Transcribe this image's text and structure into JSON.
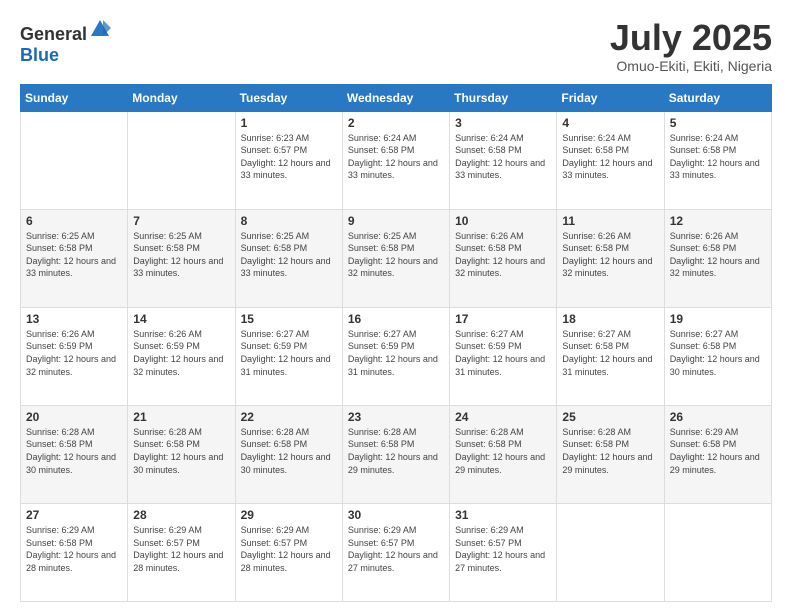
{
  "logo": {
    "text_general": "General",
    "text_blue": "Blue"
  },
  "header": {
    "month": "July 2025",
    "location": "Omuo-Ekiti, Ekiti, Nigeria"
  },
  "days_of_week": [
    "Sunday",
    "Monday",
    "Tuesday",
    "Wednesday",
    "Thursday",
    "Friday",
    "Saturday"
  ],
  "weeks": [
    [
      {
        "day": "",
        "sunrise": "",
        "sunset": "",
        "daylight": ""
      },
      {
        "day": "",
        "sunrise": "",
        "sunset": "",
        "daylight": ""
      },
      {
        "day": "1",
        "sunrise": "Sunrise: 6:23 AM",
        "sunset": "Sunset: 6:57 PM",
        "daylight": "Daylight: 12 hours and 33 minutes."
      },
      {
        "day": "2",
        "sunrise": "Sunrise: 6:24 AM",
        "sunset": "Sunset: 6:58 PM",
        "daylight": "Daylight: 12 hours and 33 minutes."
      },
      {
        "day": "3",
        "sunrise": "Sunrise: 6:24 AM",
        "sunset": "Sunset: 6:58 PM",
        "daylight": "Daylight: 12 hours and 33 minutes."
      },
      {
        "day": "4",
        "sunrise": "Sunrise: 6:24 AM",
        "sunset": "Sunset: 6:58 PM",
        "daylight": "Daylight: 12 hours and 33 minutes."
      },
      {
        "day": "5",
        "sunrise": "Sunrise: 6:24 AM",
        "sunset": "Sunset: 6:58 PM",
        "daylight": "Daylight: 12 hours and 33 minutes."
      }
    ],
    [
      {
        "day": "6",
        "sunrise": "Sunrise: 6:25 AM",
        "sunset": "Sunset: 6:58 PM",
        "daylight": "Daylight: 12 hours and 33 minutes."
      },
      {
        "day": "7",
        "sunrise": "Sunrise: 6:25 AM",
        "sunset": "Sunset: 6:58 PM",
        "daylight": "Daylight: 12 hours and 33 minutes."
      },
      {
        "day": "8",
        "sunrise": "Sunrise: 6:25 AM",
        "sunset": "Sunset: 6:58 PM",
        "daylight": "Daylight: 12 hours and 33 minutes."
      },
      {
        "day": "9",
        "sunrise": "Sunrise: 6:25 AM",
        "sunset": "Sunset: 6:58 PM",
        "daylight": "Daylight: 12 hours and 32 minutes."
      },
      {
        "day": "10",
        "sunrise": "Sunrise: 6:26 AM",
        "sunset": "Sunset: 6:58 PM",
        "daylight": "Daylight: 12 hours and 32 minutes."
      },
      {
        "day": "11",
        "sunrise": "Sunrise: 6:26 AM",
        "sunset": "Sunset: 6:58 PM",
        "daylight": "Daylight: 12 hours and 32 minutes."
      },
      {
        "day": "12",
        "sunrise": "Sunrise: 6:26 AM",
        "sunset": "Sunset: 6:58 PM",
        "daylight": "Daylight: 12 hours and 32 minutes."
      }
    ],
    [
      {
        "day": "13",
        "sunrise": "Sunrise: 6:26 AM",
        "sunset": "Sunset: 6:59 PM",
        "daylight": "Daylight: 12 hours and 32 minutes."
      },
      {
        "day": "14",
        "sunrise": "Sunrise: 6:26 AM",
        "sunset": "Sunset: 6:59 PM",
        "daylight": "Daylight: 12 hours and 32 minutes."
      },
      {
        "day": "15",
        "sunrise": "Sunrise: 6:27 AM",
        "sunset": "Sunset: 6:59 PM",
        "daylight": "Daylight: 12 hours and 31 minutes."
      },
      {
        "day": "16",
        "sunrise": "Sunrise: 6:27 AM",
        "sunset": "Sunset: 6:59 PM",
        "daylight": "Daylight: 12 hours and 31 minutes."
      },
      {
        "day": "17",
        "sunrise": "Sunrise: 6:27 AM",
        "sunset": "Sunset: 6:59 PM",
        "daylight": "Daylight: 12 hours and 31 minutes."
      },
      {
        "day": "18",
        "sunrise": "Sunrise: 6:27 AM",
        "sunset": "Sunset: 6:58 PM",
        "daylight": "Daylight: 12 hours and 31 minutes."
      },
      {
        "day": "19",
        "sunrise": "Sunrise: 6:27 AM",
        "sunset": "Sunset: 6:58 PM",
        "daylight": "Daylight: 12 hours and 30 minutes."
      }
    ],
    [
      {
        "day": "20",
        "sunrise": "Sunrise: 6:28 AM",
        "sunset": "Sunset: 6:58 PM",
        "daylight": "Daylight: 12 hours and 30 minutes."
      },
      {
        "day": "21",
        "sunrise": "Sunrise: 6:28 AM",
        "sunset": "Sunset: 6:58 PM",
        "daylight": "Daylight: 12 hours and 30 minutes."
      },
      {
        "day": "22",
        "sunrise": "Sunrise: 6:28 AM",
        "sunset": "Sunset: 6:58 PM",
        "daylight": "Daylight: 12 hours and 30 minutes."
      },
      {
        "day": "23",
        "sunrise": "Sunrise: 6:28 AM",
        "sunset": "Sunset: 6:58 PM",
        "daylight": "Daylight: 12 hours and 29 minutes."
      },
      {
        "day": "24",
        "sunrise": "Sunrise: 6:28 AM",
        "sunset": "Sunset: 6:58 PM",
        "daylight": "Daylight: 12 hours and 29 minutes."
      },
      {
        "day": "25",
        "sunrise": "Sunrise: 6:28 AM",
        "sunset": "Sunset: 6:58 PM",
        "daylight": "Daylight: 12 hours and 29 minutes."
      },
      {
        "day": "26",
        "sunrise": "Sunrise: 6:29 AM",
        "sunset": "Sunset: 6:58 PM",
        "daylight": "Daylight: 12 hours and 29 minutes."
      }
    ],
    [
      {
        "day": "27",
        "sunrise": "Sunrise: 6:29 AM",
        "sunset": "Sunset: 6:58 PM",
        "daylight": "Daylight: 12 hours and 28 minutes."
      },
      {
        "day": "28",
        "sunrise": "Sunrise: 6:29 AM",
        "sunset": "Sunset: 6:57 PM",
        "daylight": "Daylight: 12 hours and 28 minutes."
      },
      {
        "day": "29",
        "sunrise": "Sunrise: 6:29 AM",
        "sunset": "Sunset: 6:57 PM",
        "daylight": "Daylight: 12 hours and 28 minutes."
      },
      {
        "day": "30",
        "sunrise": "Sunrise: 6:29 AM",
        "sunset": "Sunset: 6:57 PM",
        "daylight": "Daylight: 12 hours and 27 minutes."
      },
      {
        "day": "31",
        "sunrise": "Sunrise: 6:29 AM",
        "sunset": "Sunset: 6:57 PM",
        "daylight": "Daylight: 12 hours and 27 minutes."
      },
      {
        "day": "",
        "sunrise": "",
        "sunset": "",
        "daylight": ""
      },
      {
        "day": "",
        "sunrise": "",
        "sunset": "",
        "daylight": ""
      }
    ]
  ]
}
